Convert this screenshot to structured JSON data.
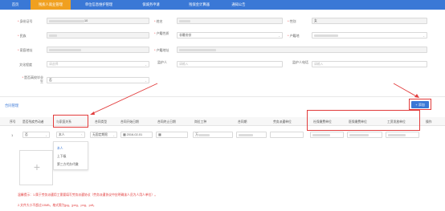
{
  "nav": {
    "items": [
      {
        "label": "首页",
        "active": false
      },
      {
        "label": "残疾人就业管理",
        "active": true
      },
      {
        "label": "单位信息维护管理",
        "active": false
      },
      {
        "label": "保城务申请",
        "active": false
      },
      {
        "label": "残保金计算器",
        "active": false
      },
      {
        "label": "通知公告",
        "active": false
      }
    ]
  },
  "form": {
    "id_no_label": "身份证号",
    "id_no_value": "10",
    "name_label": "姓名",
    "gender_label": "性别",
    "gender_value": "女",
    "nation_label": "民族",
    "hukou_nature_label": "户籍性质",
    "hukou_nature_value": "非最份份",
    "hukou_place_label": "户籍地",
    "household_addr_label": "家庭地址",
    "hukou_addr_label": "户籍地址",
    "education_label": "文化程度",
    "education_placeholder": "请选择",
    "guardian_label": "监护人",
    "guardian_placeholder": "请输入",
    "guardian_phone_label": "监护人电话",
    "guardian_phone_placeholder": "请输入",
    "graduate_label": "是否高校毕业生",
    "graduate_value": "否"
  },
  "contract": {
    "section_title": "合同管理",
    "add_button": "+ 添加",
    "headers": [
      "序号",
      "是否残疾劳动者",
      "与家庭关系",
      "合同类型",
      "合同开始日期",
      "合同终止日期",
      "岗位工种",
      "合同期",
      "劳务派遣单位",
      "社保缴费单位",
      "医保缴费单位",
      "工资发放单位",
      "操作"
    ],
    "row": {
      "index": "1",
      "is_disabled_worker": "否",
      "relationship": "本人",
      "contract_type": "无固定期限",
      "start_date": "2016-02-01",
      "position": "万"
    },
    "relationship_options": [
      "本人",
      "上下级",
      "第三方代办代缴"
    ]
  },
  "notes": [
    "温馨提示：1.属于劳务派遣用工需要填写劳务派遣协议（劳务派遣协议中应明确该人员为人用人单位）。",
    "2.文件大小不超过10MB，格式需为jpg、jpeg、png、pdf。"
  ],
  "colors": {
    "primary": "#3a78d6",
    "nav_active": "#f0a020",
    "highlight": "#e23c3c"
  }
}
